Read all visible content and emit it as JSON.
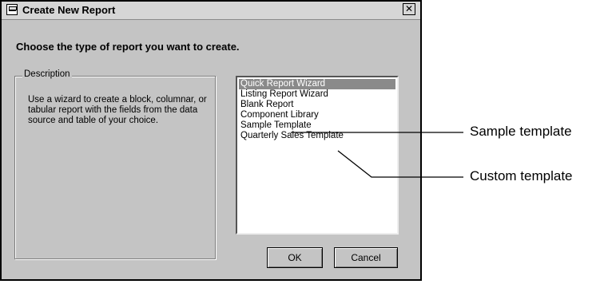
{
  "dialog": {
    "title": "Create New Report",
    "close_glyph": "✕",
    "heading": "Choose the type of report you want to create.",
    "description_label": "Description",
    "description_text": "Use a wizard to create a block, columnar, or tabular report with the fields from the data source and table of your choice.",
    "report_types": [
      "Quick Report Wizard",
      "Listing Report Wizard",
      "Blank Report",
      "Component Library",
      "Sample Template",
      "Quarterly Sales Template"
    ],
    "selected_index": 0,
    "ok_label": "OK",
    "cancel_label": "Cancel"
  },
  "callouts": {
    "sample": "Sample template",
    "custom": "Custom template"
  },
  "colors": {
    "dialog_bg": "#c4c4c4",
    "selection": "#8a8a8a"
  }
}
